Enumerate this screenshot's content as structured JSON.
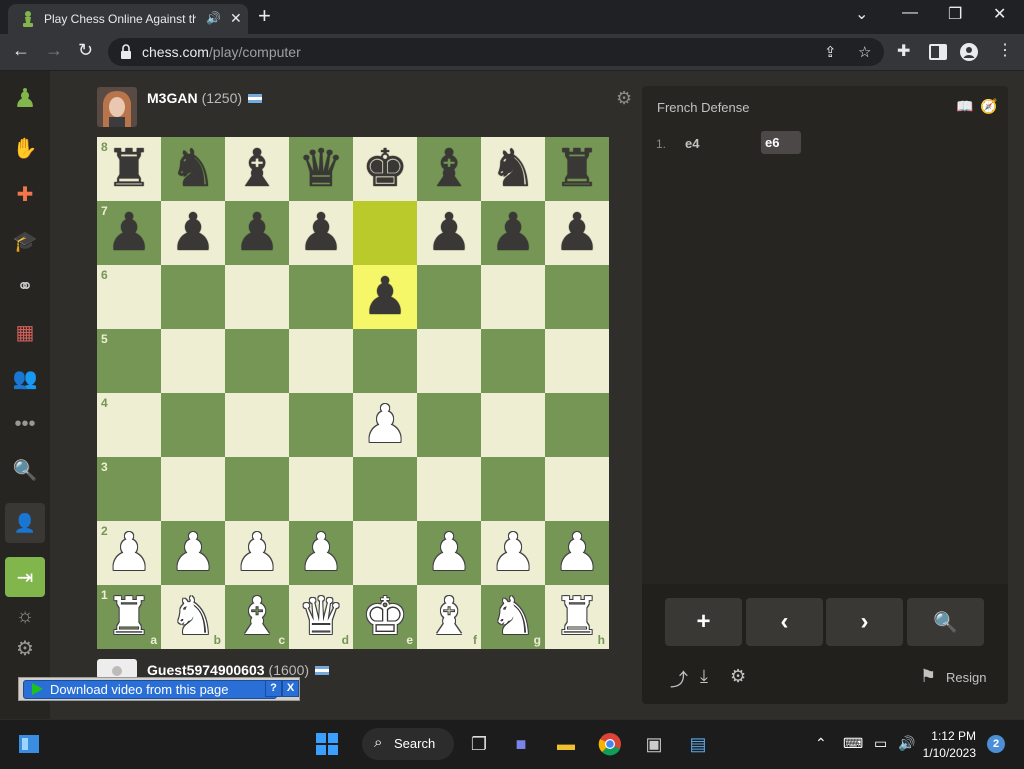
{
  "browser": {
    "tab_title": "Play Chess Online Against th",
    "url_domain": "chess.com",
    "url_path": "/play/computer",
    "new_tab_glyph": "+",
    "tab_close_glyph": "✕"
  },
  "players": {
    "top": {
      "name": "M3GAN",
      "rating": "(1250)"
    },
    "bottom": {
      "name": "Guest5974900603",
      "rating": "(1600)"
    }
  },
  "board": {
    "orientation": "white-bottom",
    "ranks_labels": [
      "8",
      "7",
      "6",
      "5",
      "4",
      "3",
      "2",
      "1"
    ],
    "files_labels": [
      "a",
      "b",
      "c",
      "d",
      "e",
      "f",
      "g",
      "h"
    ],
    "position": [
      [
        "br",
        "bn",
        "bb",
        "bq",
        "bk",
        "bb",
        "bn",
        "br"
      ],
      [
        "bp",
        "bp",
        "bp",
        "bp",
        "",
        "bp",
        "bp",
        "bp"
      ],
      [
        "",
        "",
        "",
        "",
        "bp",
        "",
        "",
        ""
      ],
      [
        "",
        "",
        "",
        "",
        "",
        "",
        "",
        ""
      ],
      [
        "",
        "",
        "",
        "",
        "wp",
        "",
        "",
        ""
      ],
      [
        "",
        "",
        "",
        "",
        "",
        "",
        "",
        ""
      ],
      [
        "wp",
        "wp",
        "wp",
        "wp",
        "",
        "wp",
        "wp",
        "wp"
      ],
      [
        "wr",
        "wn",
        "wb",
        "wq",
        "wk",
        "wb",
        "wn",
        "wr"
      ]
    ],
    "last_move": {
      "from": "e7",
      "to": "e6"
    }
  },
  "panel": {
    "opening_name": "French Defense",
    "moves": [
      {
        "number": "1.",
        "white": "e4",
        "black": "e6"
      }
    ],
    "resign_label": "Resign"
  },
  "download_bar": {
    "label": "Download video from this page",
    "help": "?",
    "close": "X"
  },
  "taskbar": {
    "search_label": "Search",
    "time": "1:12 PM",
    "date": "1/10/2023",
    "notifications": "2"
  },
  "colors": {
    "board_light": "#eeeed2",
    "board_dark": "#769656",
    "highlight_light": "#f6f669",
    "highlight_dark": "#baca2b",
    "accent_green": "#81b64c",
    "background": "#302e2b"
  }
}
